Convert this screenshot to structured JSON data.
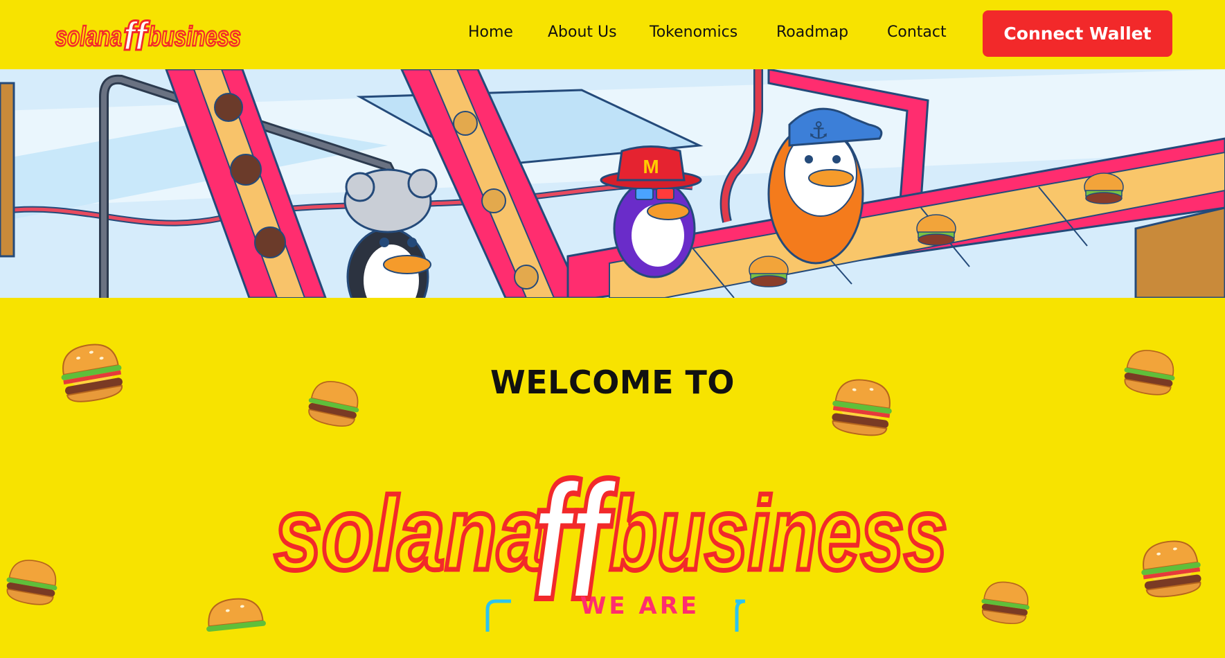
{
  "brand": {
    "logo_text": "solana business",
    "logo_mark": "ff"
  },
  "nav": {
    "items": [
      {
        "label": "Home"
      },
      {
        "label": "About Us"
      },
      {
        "label": "Tokenomics"
      },
      {
        "label": "Roadmap"
      },
      {
        "label": "Contact"
      }
    ],
    "cta_label": "Connect Wallet"
  },
  "hero": {
    "cap_letter": "M"
  },
  "main": {
    "welcome": "WELCOME TO",
    "tagline": "WE ARE"
  },
  "colors": {
    "background": "#f7e300",
    "accent_red": "#f2292a",
    "pink": "#ff2d6f",
    "cyan": "#2bc4f0"
  }
}
